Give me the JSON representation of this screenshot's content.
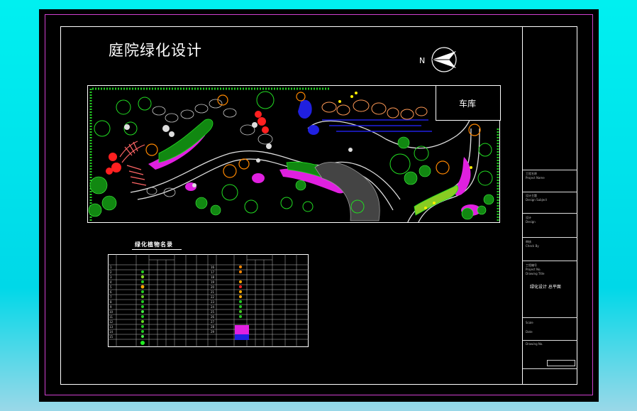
{
  "drawing": {
    "title": "庭院绿化设计",
    "garage_label": "车库",
    "north_label": "N"
  },
  "table": {
    "title": "绿化植物名录"
  },
  "title_block": {
    "row_labels": [
      "Project Name",
      "Design Subject",
      "Design",
      "Check By",
      "Project No.",
      "Drawing Title",
      "Scale",
      "Date",
      "Drawing No."
    ],
    "drawing_title_value": "绿化设计 总平面"
  },
  "colors": {
    "sheet_background": "#000000",
    "frame_pink": "#d040d0",
    "outer_background": "#00e8f0",
    "hedge_green": "#22cc22",
    "flower_magenta": "#e020e0",
    "water_blue": "#2020e0",
    "shrub_red": "#ff2020",
    "rock_white": "#dddddd",
    "tree_orange": "#ff8800"
  }
}
